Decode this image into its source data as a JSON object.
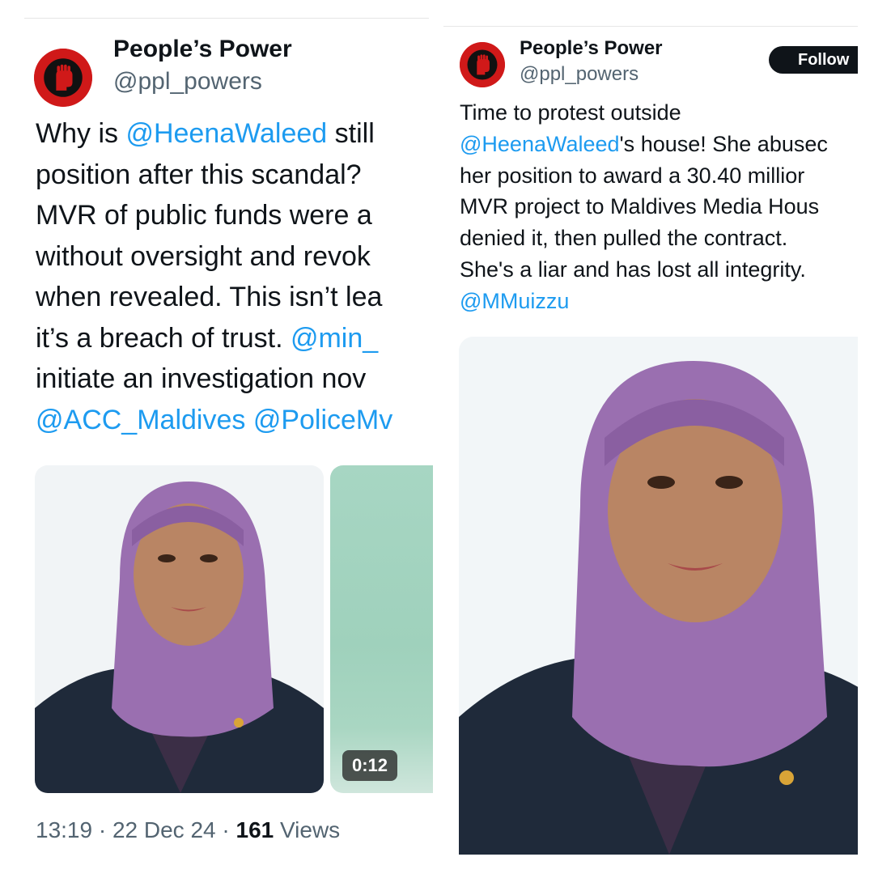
{
  "left_tweet": {
    "name": "People’s Power",
    "handle": "@ppl_powers",
    "lines": [
      [
        {
          "t": "Why is "
        },
        {
          "t": "@HeenaWaleed",
          "m": true
        },
        {
          "t": " still"
        }
      ],
      [
        {
          "t": "position after this scandal?"
        }
      ],
      [
        {
          "t": "MVR of public funds were a"
        }
      ],
      [
        {
          "t": "without oversight and revok"
        }
      ],
      [
        {
          "t": "when revealed. This isn’t lea"
        }
      ],
      [
        {
          "t": "it’s a breach of trust. "
        },
        {
          "t": "@min_",
          "m": true
        }
      ],
      [
        {
          "t": "initiate an investigation nov"
        }
      ],
      [
        {
          "t": "@ACC_Maldives @PoliceMv",
          "m": true
        }
      ]
    ],
    "video_duration": "0:12",
    "time": "13:19",
    "date": "22 Dec 24",
    "views_count": "161",
    "views_label": "Views"
  },
  "right_tweet": {
    "name": "People’s Power",
    "handle": "@ppl_powers",
    "follow_label": "Follow",
    "lines": [
      [
        {
          "t": "Time to protest outside"
        }
      ],
      [
        {
          "t": "@HeenaWaleed",
          "m": true
        },
        {
          "t": "'s house! She abusec"
        }
      ],
      [
        {
          "t": "her position to award a 30.40 millior"
        }
      ],
      [
        {
          "t": "MVR project to Maldives Media Hous"
        }
      ],
      [
        {
          "t": "denied it, then pulled the contract."
        }
      ],
      [
        {
          "t": "She's a liar and has lost all integrity."
        }
      ],
      [
        {
          "t": "@MMuizzu",
          "m": true
        }
      ]
    ]
  },
  "colors": {
    "link": "#1d9bf0",
    "muted": "#536471",
    "text": "#0f1419",
    "avatar": "#d01919",
    "hijab": "#9a6fb0",
    "blazer": "#1f2a3a"
  },
  "icons": {
    "avatar": "raised-fist-logo"
  }
}
